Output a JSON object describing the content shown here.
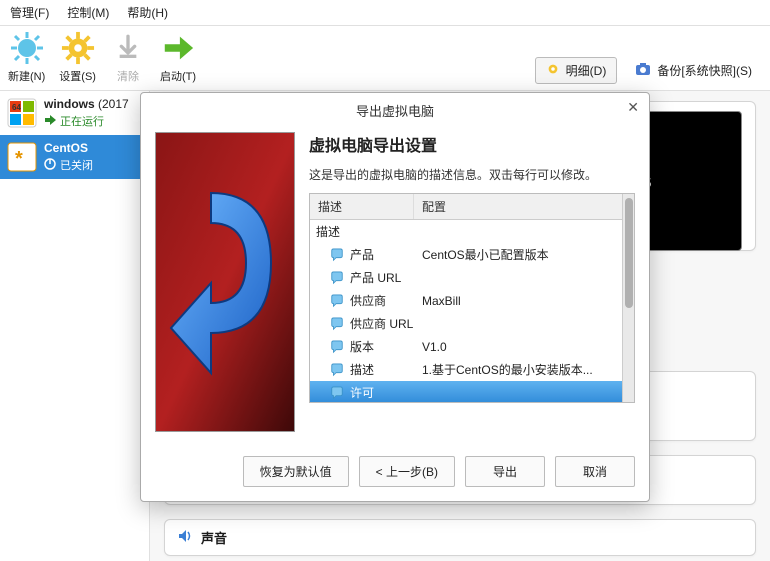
{
  "menu": {
    "manage": "管理(F)",
    "control": "控制(M)",
    "help": "帮助(H)"
  },
  "toolbar": {
    "new": "新建(N)",
    "settings": "设置(S)",
    "clear": "清除",
    "start": "启动(T)",
    "detail": "明细(D)",
    "backup": "备份[系统快照](S)"
  },
  "vms": [
    {
      "name": "windows",
      "suffix": "(2017",
      "state": "正在运行"
    },
    {
      "name": "CentOS",
      "state": "已关闭"
    }
  ],
  "preview_text": "›s",
  "details_section": {
    "sound": "声音"
  },
  "dialog": {
    "title": "导出虚拟电脑",
    "heading": "虚拟电脑导出设置",
    "desc": "这是导出的虚拟电脑的描述信息。双击每行可以修改。",
    "col1": "描述",
    "col2": "配置",
    "rows": [
      {
        "section": true,
        "label": "描述",
        "value": ""
      },
      {
        "label": "产品",
        "value": "CentOS最小已配置版本"
      },
      {
        "label": "产品 URL",
        "value": ""
      },
      {
        "label": "供应商",
        "value": "MaxBill"
      },
      {
        "label": "供应商 URL",
        "value": ""
      },
      {
        "label": "版本",
        "value": "V1.0"
      },
      {
        "label": "描述",
        "value": "1.基于CentOS的最小安装版本..."
      },
      {
        "label": "许可",
        "value": "",
        "selected": true
      }
    ],
    "buttons": {
      "restore": "恢复为默认值",
      "back": "< 上一步(B)",
      "export": "导出",
      "cancel": "取消"
    }
  }
}
